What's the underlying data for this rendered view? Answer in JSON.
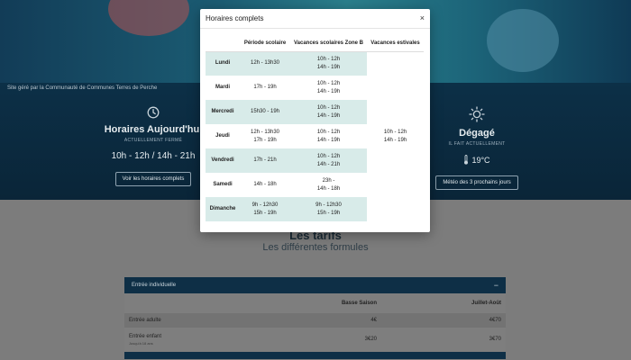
{
  "site": {
    "credit": "Site géré par la Communauté de Communes Terres de Perche"
  },
  "today": {
    "icon": "clock-icon",
    "title": "Horaires Aujourd'hui",
    "status": "ACTUELLEMENT FERMÉ",
    "hours": "10h - 12h / 14h - 21h",
    "button": "Voir les horaires complets"
  },
  "weather": {
    "icon": "sun-icon",
    "title": "Dégagé",
    "status": "IL FAIT ACTUELLEMENT",
    "temp_icon": "thermometer-icon",
    "temperature": "19°C",
    "button": "Météo des 3 prochains jours"
  },
  "tarifs": {
    "title": "Les tarifs",
    "subtitle": "Les différentes formules",
    "accordion_label": "Entrée individuelle",
    "accordion_toggle": "−",
    "col_season_low": "Basse Saison",
    "col_season_high": "Juillet-Août",
    "rows": [
      {
        "label": "Entrée adulte",
        "note": "",
        "low": "4€",
        "high": "4€70"
      },
      {
        "label": "Entrée enfant",
        "note": "Jusqu'à 18 ans",
        "low": "3€20",
        "high": "3€70"
      }
    ]
  },
  "modal": {
    "title": "Horaires complets",
    "close": "×",
    "columns": [
      "",
      "Période scolaire",
      "Vacances scolaires Zone B",
      "Vacances estivales"
    ],
    "summer_hours": [
      "10h - 12h",
      "14h - 19h"
    ],
    "days": [
      {
        "day": "Lundi",
        "school": [
          "12h - 13h30"
        ],
        "holidays": [
          "10h - 12h",
          "14h - 19h"
        ]
      },
      {
        "day": "Mardi",
        "school": [
          "17h - 19h"
        ],
        "holidays": [
          "10h - 12h",
          "14h - 19h"
        ]
      },
      {
        "day": "Mercredi",
        "school": [
          "15h30 - 19h"
        ],
        "holidays": [
          "10h - 12h",
          "14h - 19h"
        ]
      },
      {
        "day": "Jeudi",
        "school": [
          "12h - 13h30",
          "17h - 19h"
        ],
        "holidays": [
          "10h - 12h",
          "14h - 19h"
        ]
      },
      {
        "day": "Vendredi",
        "school": [
          "17h - 21h"
        ],
        "holidays": [
          "10h - 12h",
          "14h - 21h"
        ]
      },
      {
        "day": "Samedi",
        "school": [
          "14h - 18h"
        ],
        "holidays": [
          "23h -",
          "14h - 18h"
        ]
      },
      {
        "day": "Dimanche",
        "school": [
          "9h - 12h30",
          "15h - 19h"
        ],
        "holidays": [
          "9h - 12h30",
          "15h - 19h"
        ]
      }
    ]
  },
  "colors": {
    "hero": "#0c2f46",
    "row_shade": "#d8ebe9",
    "accordion": "#0e2f46"
  }
}
